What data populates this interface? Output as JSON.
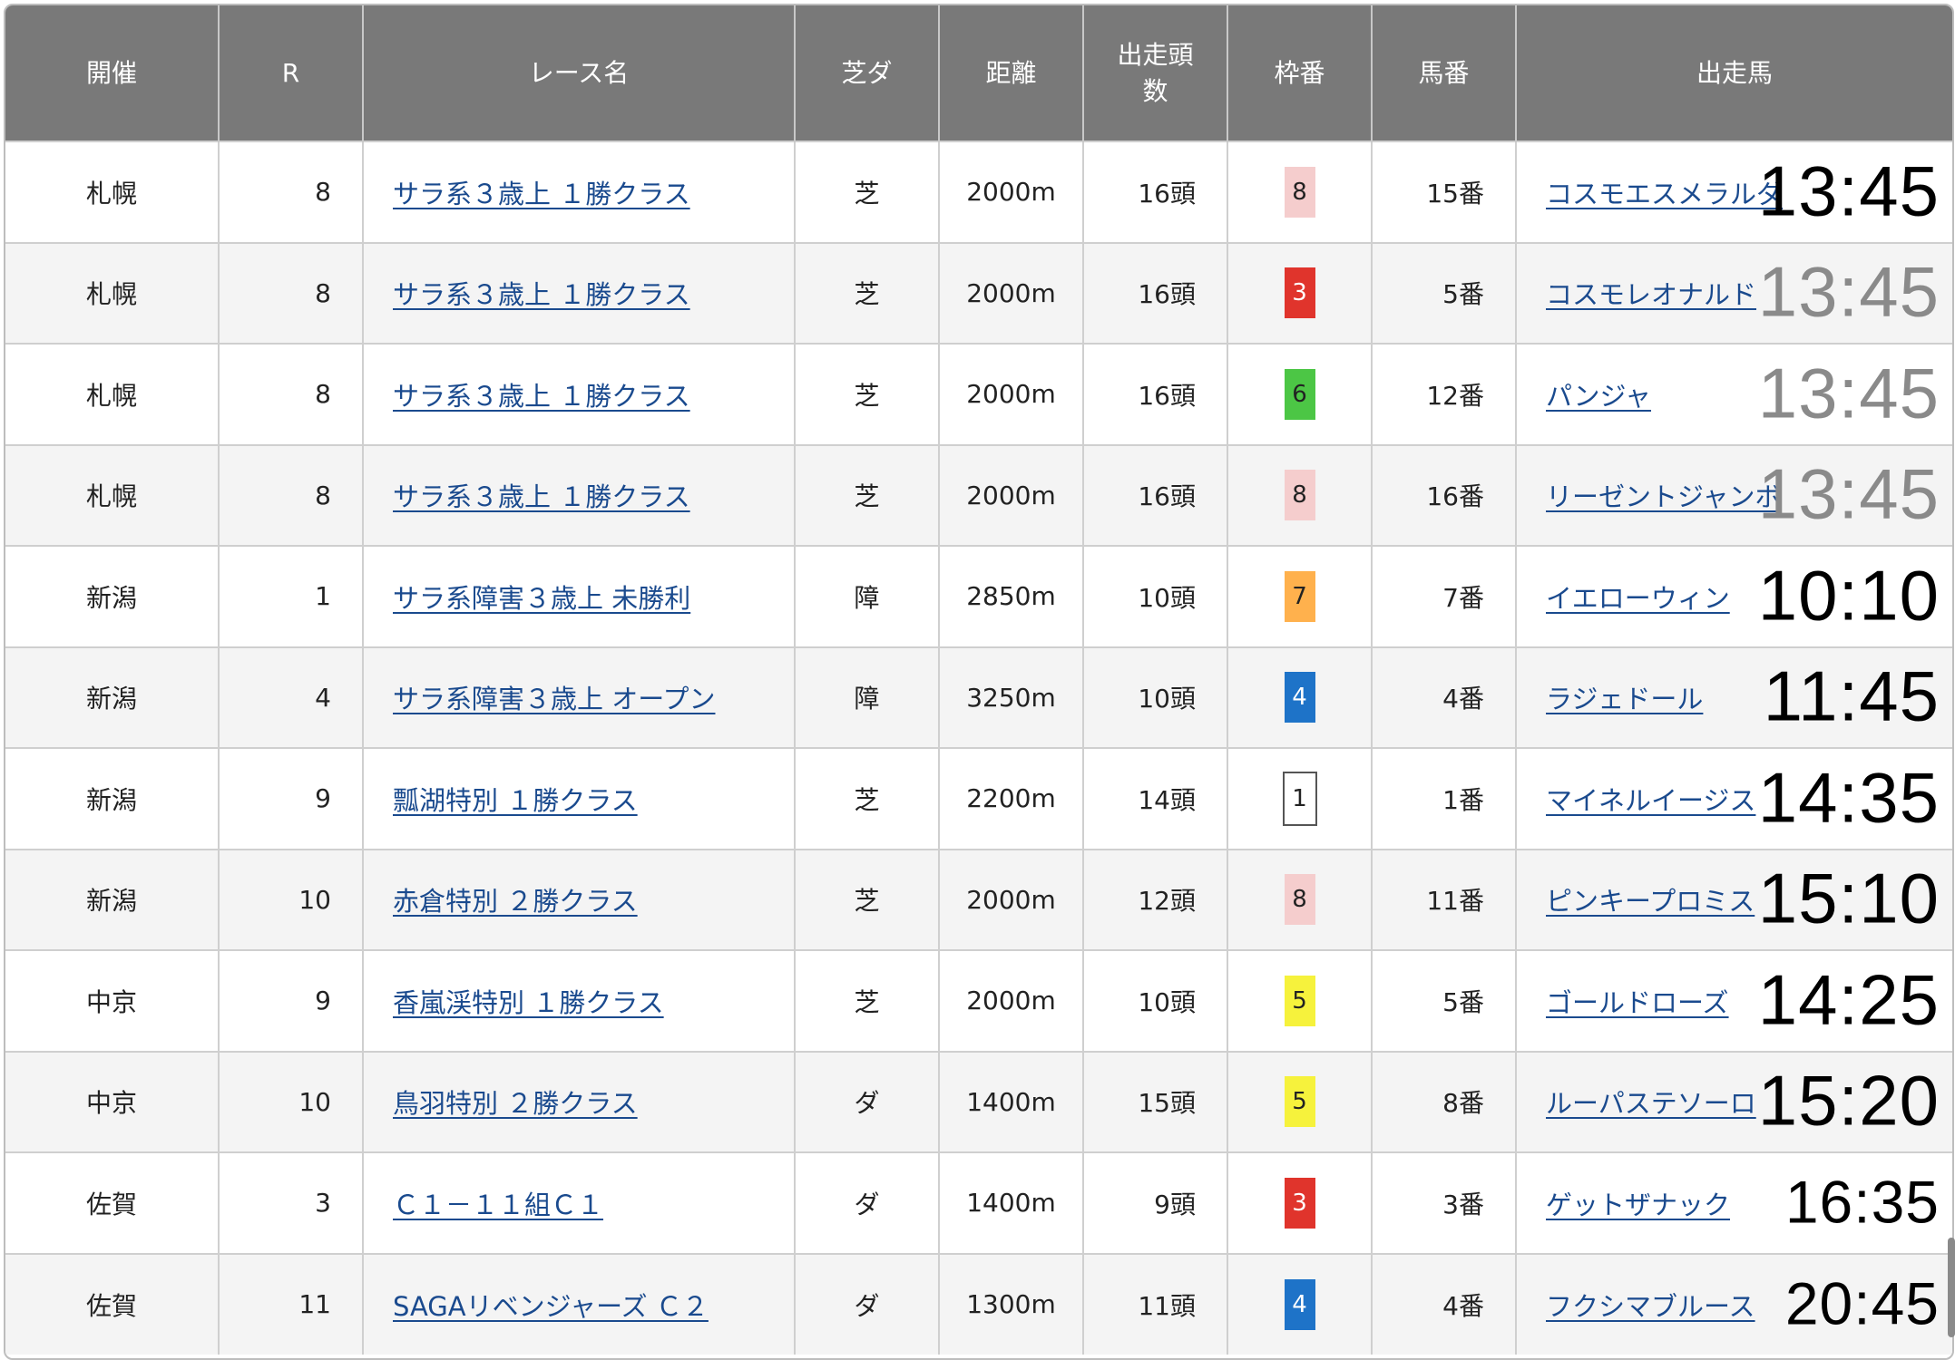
{
  "columns": [
    "開催",
    "R",
    "レース名",
    "芝ダ",
    "距離",
    "出走頭数",
    "枠番",
    "馬番",
    "出走馬"
  ],
  "waku_colors": {
    "1": {
      "bg": "#ffffff",
      "fg": "#222222",
      "border": "#555555"
    },
    "3": {
      "bg": "#e0342c",
      "fg": "#ffffff",
      "border": "none"
    },
    "4": {
      "bg": "#1e73c8",
      "fg": "#ffffff",
      "border": "none"
    },
    "5": {
      "bg": "#f6f23c",
      "fg": "#222222",
      "border": "none"
    },
    "6": {
      "bg": "#4cc645",
      "fg": "#222222",
      "border": "none"
    },
    "7": {
      "bg": "#ffb14d",
      "fg": "#222222",
      "border": "none"
    },
    "8": {
      "bg": "#f5cdcd",
      "fg": "#222222",
      "border": "none"
    }
  },
  "rows": [
    {
      "venue": "札幌",
      "r": "8",
      "race": "サラ系３歳上 １勝クラス",
      "surface": "芝",
      "distance": "2000m",
      "runners": "16頭",
      "waku": "8",
      "uma": "15番",
      "horse": "コスモエスメラルダ",
      "time": "13:45",
      "time_color": "#000000"
    },
    {
      "venue": "札幌",
      "r": "8",
      "race": "サラ系３歳上 １勝クラス",
      "surface": "芝",
      "distance": "2000m",
      "runners": "16頭",
      "waku": "3",
      "uma": "5番",
      "horse": "コスモレオナルド",
      "time": "13:45",
      "time_color": "#8a8a8a"
    },
    {
      "venue": "札幌",
      "r": "8",
      "race": "サラ系３歳上 １勝クラス",
      "surface": "芝",
      "distance": "2000m",
      "runners": "16頭",
      "waku": "6",
      "uma": "12番",
      "horse": "パンジャ",
      "time": "13:45",
      "time_color": "#8a8a8a"
    },
    {
      "venue": "札幌",
      "r": "8",
      "race": "サラ系３歳上 １勝クラス",
      "surface": "芝",
      "distance": "2000m",
      "runners": "16頭",
      "waku": "8",
      "uma": "16番",
      "horse": "リーゼントジャンボ",
      "time": "13:45",
      "time_color": "#8a8a8a"
    },
    {
      "venue": "新潟",
      "r": "1",
      "race": "サラ系障害３歳上 未勝利",
      "surface": "障",
      "distance": "2850m",
      "runners": "10頭",
      "waku": "7",
      "uma": "7番",
      "horse": "イエローウィン",
      "time": "10:10",
      "time_color": "#000000"
    },
    {
      "venue": "新潟",
      "r": "4",
      "race": "サラ系障害３歳上 オープン",
      "surface": "障",
      "distance": "3250m",
      "runners": "10頭",
      "waku": "4",
      "uma": "4番",
      "horse": "ラジェドール",
      "time": "11:45",
      "time_color": "#000000"
    },
    {
      "venue": "新潟",
      "r": "9",
      "race": "瓢湖特別 １勝クラス",
      "surface": "芝",
      "distance": "2200m",
      "runners": "14頭",
      "waku": "1",
      "uma": "1番",
      "horse": "マイネルイージス",
      "time": "14:35",
      "time_color": "#000000"
    },
    {
      "venue": "新潟",
      "r": "10",
      "race": "赤倉特別 ２勝クラス",
      "surface": "芝",
      "distance": "2000m",
      "runners": "12頭",
      "waku": "8",
      "uma": "11番",
      "horse": "ピンキープロミス",
      "time": "15:10",
      "time_color": "#000000"
    },
    {
      "venue": "中京",
      "r": "9",
      "race": "香嵐渓特別 １勝クラス",
      "surface": "芝",
      "distance": "2000m",
      "runners": "10頭",
      "waku": "5",
      "uma": "5番",
      "horse": "ゴールドローズ",
      "time": "14:25",
      "time_color": "#000000"
    },
    {
      "venue": "中京",
      "r": "10",
      "race": "鳥羽特別 ２勝クラス",
      "surface": "ダ",
      "distance": "1400m",
      "runners": "15頭",
      "waku": "5",
      "uma": "8番",
      "horse": "ルーパステソーロ",
      "time": "15:20",
      "time_color": "#000000"
    },
    {
      "venue": "佐賀",
      "r": "3",
      "race": "Ｃ１－１１組Ｃ１",
      "surface": "ダ",
      "distance": "1400m",
      "runners": "9頭",
      "waku": "3",
      "uma": "3番",
      "horse": "ゲットザナック",
      "time": "16:35",
      "time_color": "#000000",
      "time_small": true
    },
    {
      "venue": "佐賀",
      "r": "11",
      "race": "SAGAリベンジャーズ Ｃ２",
      "surface": "ダ",
      "distance": "1300m",
      "runners": "11頭",
      "waku": "4",
      "uma": "4番",
      "horse": "フクシマブルース",
      "time": "20:45",
      "time_color": "#000000",
      "time_small": true
    }
  ]
}
